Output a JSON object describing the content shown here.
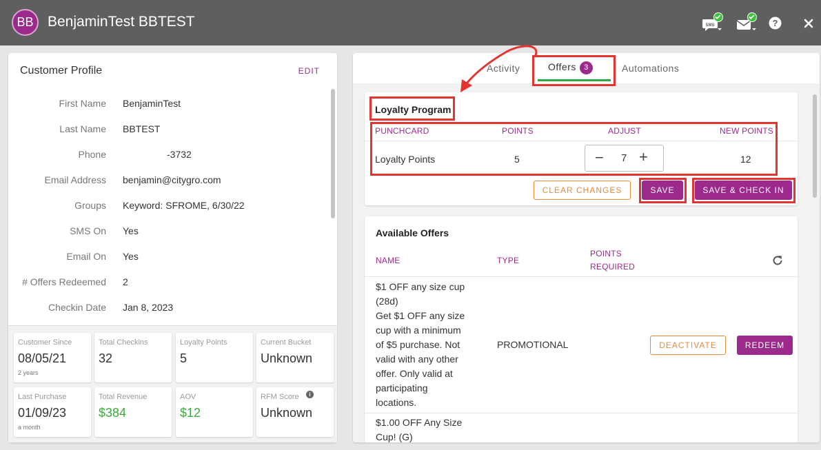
{
  "header": {
    "avatar_initials": "BB",
    "title": "BenjaminTest BBTEST",
    "sms_icon_text": "SMS"
  },
  "profile": {
    "title": "Customer Profile",
    "edit_label": "EDIT",
    "fields": [
      {
        "label": "First Name",
        "value": "BenjaminTest"
      },
      {
        "label": "Last Name",
        "value": "BBTEST"
      },
      {
        "label": "Phone",
        "value": "-3732"
      },
      {
        "label": "Email Address",
        "value": "benjamin@citygro.com"
      },
      {
        "label": "Groups",
        "value": "Keyword: SFROME, 6/30/22"
      },
      {
        "label": "SMS On",
        "value": "Yes"
      },
      {
        "label": "Email On",
        "value": "Yes"
      },
      {
        "label": "# Offers Redeemed",
        "value": "2"
      },
      {
        "label": "Checkin Date",
        "value": "Jan 8, 2023"
      }
    ]
  },
  "stats": [
    {
      "label": "Customer Since",
      "value": "08/05/21",
      "sub": "2 years"
    },
    {
      "label": "Total Checkins",
      "value": "32"
    },
    {
      "label": "Loyalty Points",
      "value": "5"
    },
    {
      "label": "Current Bucket",
      "value": "Unknown"
    },
    {
      "label": "Last Purchase",
      "value": "01/09/23",
      "sub": "a month"
    },
    {
      "label": "Total Revenue",
      "value": "$384"
    },
    {
      "label": "AOV",
      "value": "$12"
    },
    {
      "label": "RFM Score",
      "value": "Unknown",
      "info": "i"
    }
  ],
  "tabs": {
    "activity": "Activity",
    "offers": "Offers",
    "offers_count": "3",
    "automations": "Automations"
  },
  "loyalty": {
    "title": "Loyalty Program",
    "headers": {
      "punchcard": "PUNCHCARD",
      "points": "POINTS",
      "adjust": "ADJUST",
      "new_points": "NEW POINTS"
    },
    "row": {
      "name": "Loyalty Points",
      "points": "5",
      "adjust": "7",
      "new_points": "12"
    },
    "clear_label": "CLEAR CHANGES",
    "save_label": "SAVE",
    "save_checkin_label": "SAVE & CHECK IN"
  },
  "offers": {
    "title": "Available Offers",
    "headers": {
      "name": "NAME",
      "type": "TYPE",
      "points_line1": "POINTS",
      "points_line2": "REQUIRED"
    },
    "items": [
      {
        "lines": [
          "$1 OFF any size cup",
          "(28d)",
          "Get $1 OFF any size",
          "cup with a minimum",
          "of $5 purchase. Not",
          "valid with any other",
          "offer. Only valid at",
          "participating",
          "locations."
        ],
        "type": "PROMOTIONAL",
        "deactivate_label": "DEACTIVATE",
        "redeem_label": "REDEEM"
      },
      {
        "lines": [
          "$1.00 OFF Any Size",
          "Cup! (G)"
        ]
      }
    ]
  },
  "colors": {
    "accent": "#9c2a8c",
    "orange": "#e28b3b",
    "green": "#3aab3a",
    "header_bg": "#5f5f5f",
    "annotation_red": "#e3342f"
  }
}
